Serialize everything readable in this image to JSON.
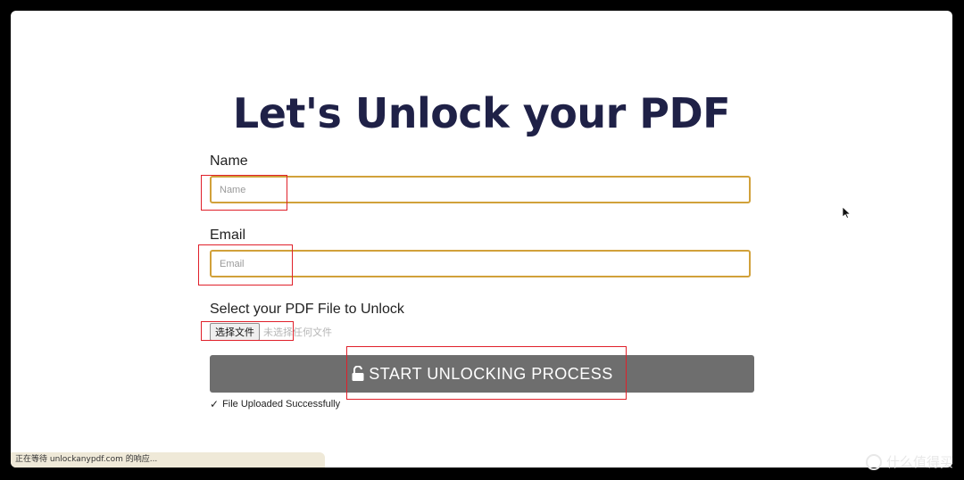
{
  "page": {
    "title": "Let's Unlock your PDF"
  },
  "form": {
    "name": {
      "label": "Name",
      "placeholder": "Name",
      "value": ""
    },
    "email": {
      "label": "Email",
      "placeholder": "Email",
      "value": ""
    },
    "file": {
      "label": "Select your PDF File to Unlock",
      "button_label": "选择文件",
      "status": "未选择任何文件"
    },
    "submit": {
      "label": "START UNLOCKING PROCESS",
      "icon": "unlock-icon"
    },
    "success_message": "File Uploaded Successfully"
  },
  "browser": {
    "status_text": "正在等待 unlockanypdf.com 的响应..."
  },
  "watermark": {
    "text": "什么值得买"
  },
  "colors": {
    "title": "#1f2147",
    "input_border": "#d1a13a",
    "button_bg": "#6e6e6e",
    "annotation": "#e0202a"
  }
}
